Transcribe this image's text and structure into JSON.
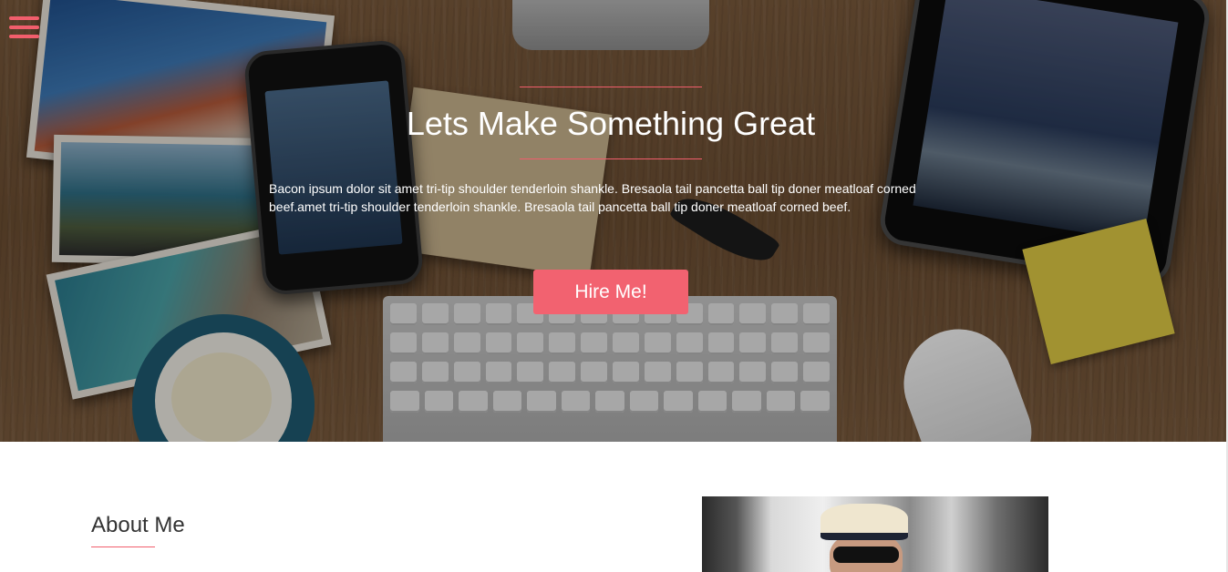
{
  "nav": {
    "menu_icon": "hamburger-menu-icon"
  },
  "hero": {
    "title": "Lets Make Something Great",
    "text": "Bacon ipsum dolor sit amet tri-tip shoulder tenderloin shankle. Bresaola tail pancetta ball tip doner meatloaf corned beef.amet tri-tip shoulder tenderloin shankle. Bresaola tail pancetta ball tip doner meatloaf corned beef.",
    "button_label": "Hire Me!"
  },
  "about": {
    "title": "About Me"
  },
  "colors": {
    "accent": "#f15e6c",
    "button": "#f26270",
    "heading_text": "#333333"
  }
}
